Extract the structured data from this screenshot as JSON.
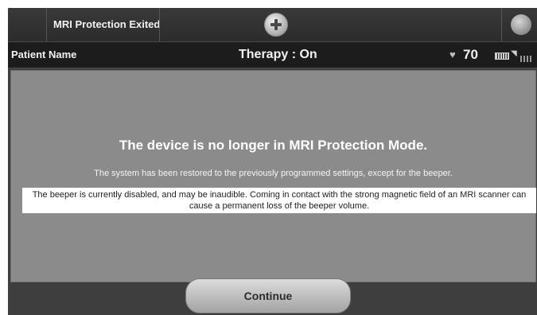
{
  "header": {
    "mode_title": "MRI Protection Exited",
    "add_icon": "plus-circle-icon",
    "corner_icon": "circle-button-icon"
  },
  "status_bar": {
    "patient_label": "Patient Name",
    "therapy_status": "Therapy : On",
    "heart_icon": "heart-icon",
    "heart_rate": "70",
    "battery_icon": "battery-icon",
    "signal_icon": "wireless-signal-icon"
  },
  "message": {
    "heading": "The device is no longer in MRI Protection Mode.",
    "restore_text": "The system has been restored to the previously programmed settings, except for the beeper.",
    "warning_text": "The beeper is currently disabled, and may be inaudible. Coming in contact with the strong magnetic field of an MRI scanner can cause a permanent loss of the beeper volume."
  },
  "actions": {
    "continue_label": "Continue"
  }
}
